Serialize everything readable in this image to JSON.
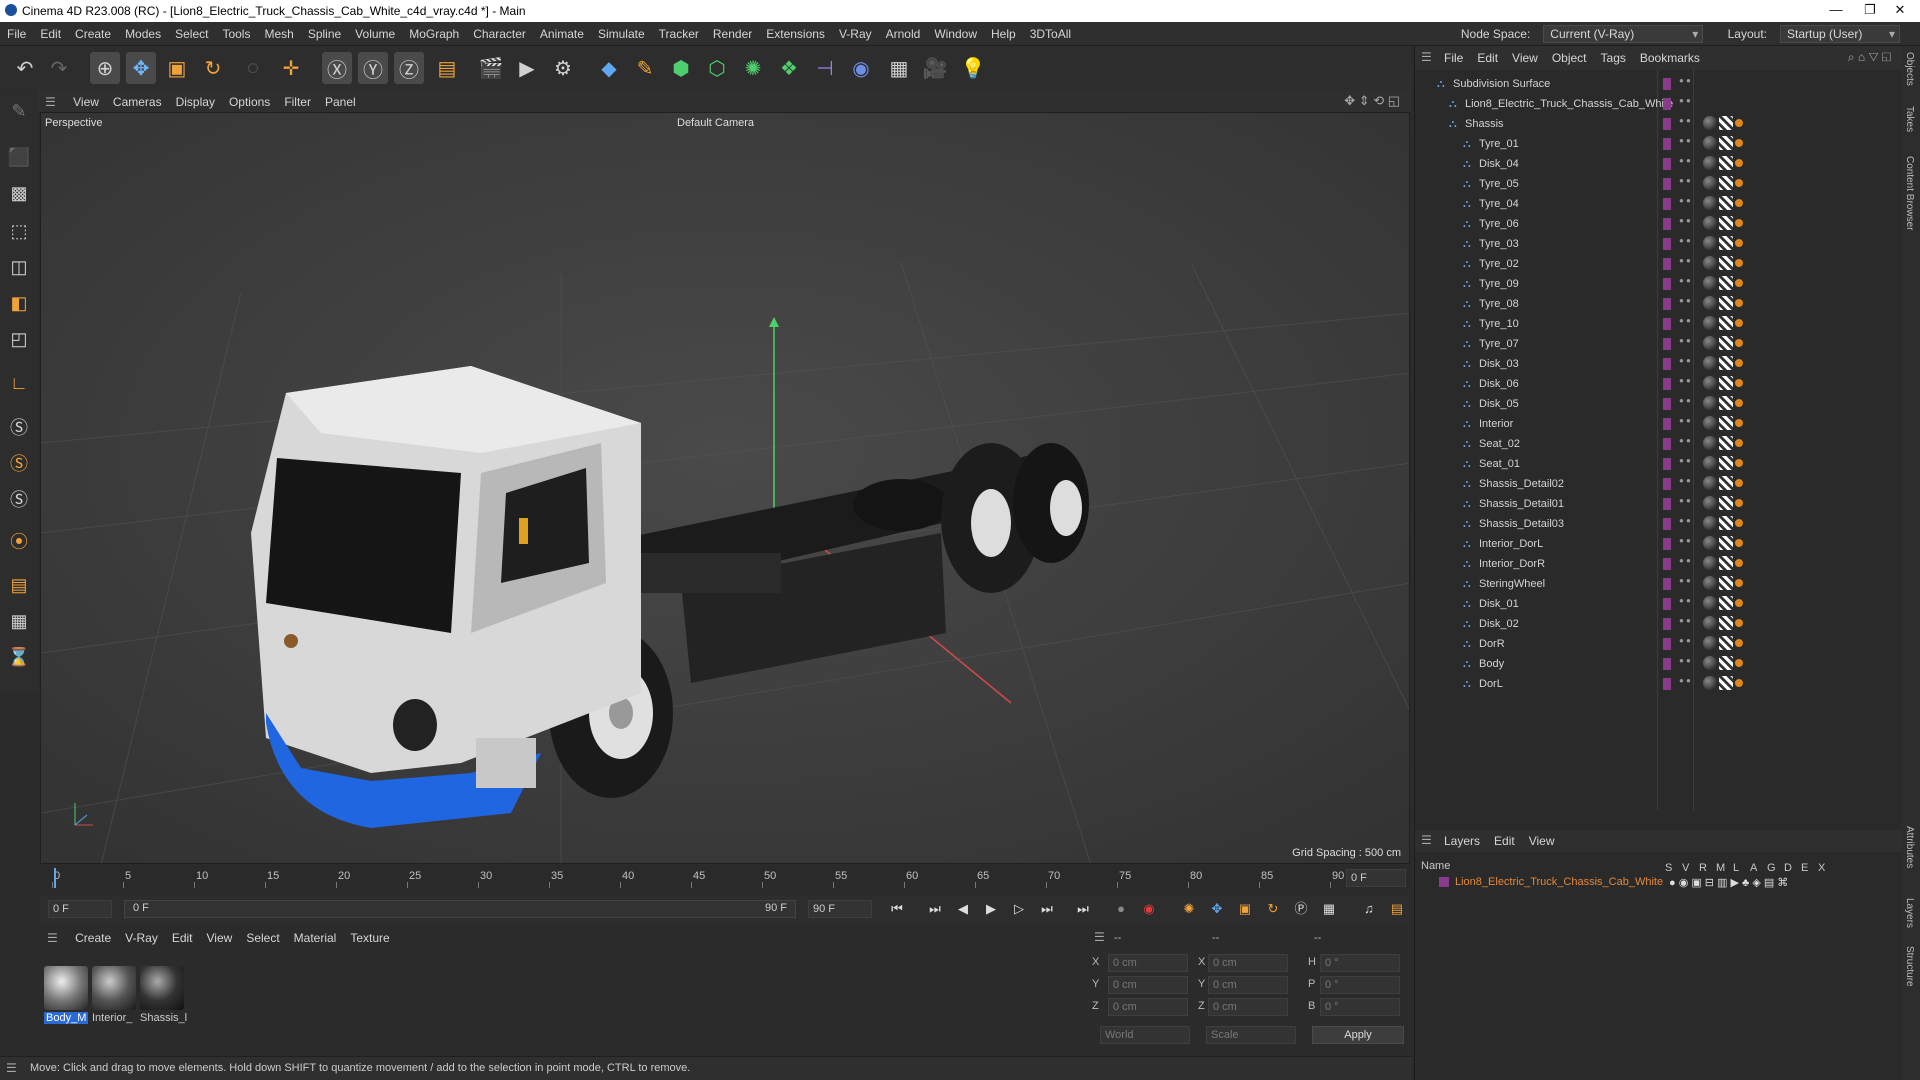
{
  "window": {
    "title": "Cinema 4D R23.008 (RC) - [Lion8_Electric_Truck_Chassis_Cab_White_c4d_vray.c4d *] - Main"
  },
  "menu": [
    "File",
    "Edit",
    "Create",
    "Modes",
    "Select",
    "Tools",
    "Mesh",
    "Spline",
    "Volume",
    "MoGraph",
    "Character",
    "Animate",
    "Simulate",
    "Tracker",
    "Render",
    "Extensions",
    "V-Ray",
    "Arnold",
    "Window",
    "Help",
    "3DToAll"
  ],
  "node_space": {
    "label": "Node Space:",
    "value": "Current (V-Ray)"
  },
  "layout": {
    "label": "Layout:",
    "value": "Startup (User)"
  },
  "viewport": {
    "menu": [
      "View",
      "Cameras",
      "Display",
      "Options",
      "Filter",
      "Panel"
    ],
    "label": "Perspective",
    "camera": "Default Camera",
    "grid_spacing": "Grid Spacing : 500 cm"
  },
  "objects_panel": {
    "menu": [
      "File",
      "Edit",
      "View",
      "Object",
      "Tags",
      "Bookmarks"
    ],
    "root": "Subdivision Surface",
    "group": "Lion8_Electric_Truck_Chassis_Cab_White",
    "sub": "Shassis",
    "items": [
      "Tyre_01",
      "Disk_04",
      "Tyre_05",
      "Tyre_04",
      "Tyre_06",
      "Tyre_03",
      "Tyre_02",
      "Tyre_09",
      "Tyre_08",
      "Tyre_10",
      "Tyre_07",
      "Disk_03",
      "Disk_06",
      "Disk_05",
      "Interior",
      "Seat_02",
      "Seat_01",
      "Shassis_Detail02",
      "Shassis_Detail01",
      "Shassis_Detail03",
      "Interior_DorL",
      "Interior_DorR",
      "SteringWheel",
      "Disk_01",
      "Disk_02",
      "DorR",
      "Body",
      "DorL"
    ]
  },
  "layers_panel": {
    "menu": [
      "Layers",
      "Edit",
      "View"
    ],
    "name_header": "Name",
    "columns": [
      "S",
      "V",
      "R",
      "M",
      "L",
      "A",
      "G",
      "D",
      "E",
      "X"
    ],
    "layer": "Lion8_Electric_Truck_Chassis_Cab_White"
  },
  "timeline": {
    "ticks": [
      "0",
      "5",
      "10",
      "15",
      "20",
      "25",
      "30",
      "35",
      "40",
      "45",
      "50",
      "55",
      "60",
      "65",
      "70",
      "75",
      "80",
      "85",
      "90"
    ],
    "end_frame": "0 F"
  },
  "transport": {
    "start": "0 F",
    "range_start": "0 F",
    "range_end": "90 F",
    "end": "90 F"
  },
  "material_panel": {
    "menu": [
      "Create",
      "V-Ray",
      "Edit",
      "View",
      "Select",
      "Material",
      "Texture"
    ],
    "materials": [
      "Body_M",
      "Interior_",
      "Shassis_l"
    ]
  },
  "coords": {
    "header": [
      "--",
      "--",
      "--"
    ],
    "rows": [
      {
        "a": "X",
        "av": "0 cm",
        "b": "X",
        "bv": "0 cm",
        "c": "H",
        "cv": "0 °"
      },
      {
        "a": "Y",
        "av": "0 cm",
        "b": "Y",
        "bv": "0 cm",
        "c": "P",
        "cv": "0 °"
      },
      {
        "a": "Z",
        "av": "0 cm",
        "b": "Z",
        "bv": "0 cm",
        "c": "B",
        "cv": "0 °"
      }
    ],
    "world": "World",
    "scale": "Scale",
    "apply": "Apply"
  },
  "status": "Move: Click and drag to move elements. Hold down SHIFT to quantize movement / add to the selection in point mode, CTRL to remove.",
  "side_tabs": [
    "Objects",
    "Takes",
    "Content Browser",
    "Attributes",
    "Layers",
    "Structure"
  ],
  "colors": {
    "accent": "#2a6ad6",
    "layer_name": "#e2883a",
    "truck_blue": "#1f66e0"
  }
}
